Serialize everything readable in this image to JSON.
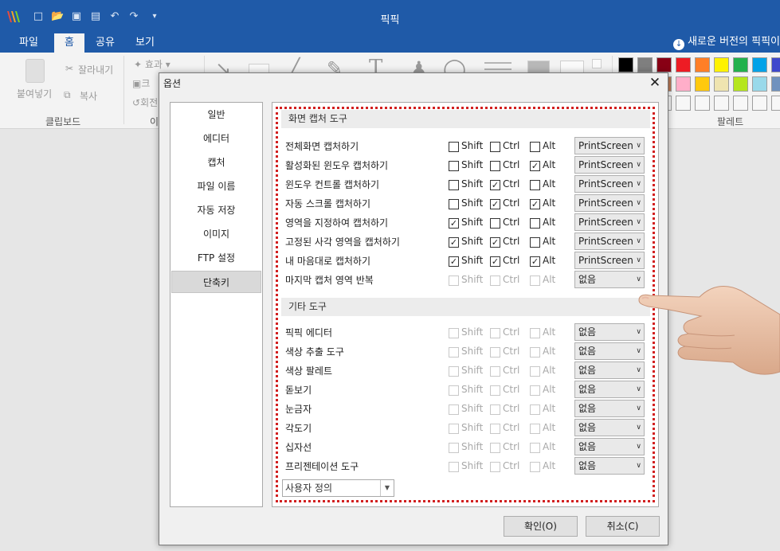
{
  "app": {
    "title": "픽픽"
  },
  "menu": {
    "tabs": [
      "파일",
      "홈",
      "공유",
      "보기"
    ],
    "update_notice": "새로운 버전의 픽픽이"
  },
  "ribbon": {
    "paste_label": "붙여넣기",
    "cut_label": "잘라내기",
    "copy_label": "복사",
    "effect_label": "효과",
    "crop_label": "크",
    "rotate_label": "회전",
    "clipboard_group": "클립보드",
    "image_group": "이",
    "palette_group": "팔레트",
    "palette_colors": [
      "#000000",
      "#7f7f7f",
      "#880015",
      "#ed1c24",
      "#ff7f27",
      "#fff200",
      "#22b14c",
      "#00a2e8",
      "#3f48cc",
      "#ffffff",
      "#c3c3c3",
      "#b97a57",
      "#ffaec9",
      "#ffc90e",
      "#efe4b0",
      "#b5e61d",
      "#99d9ea",
      "#7092be"
    ]
  },
  "dialog": {
    "title": "옵션",
    "nav": [
      "일반",
      "에디터",
      "캡처",
      "파일 이름",
      "자동 저장",
      "이미지",
      "FTP 설정",
      "단축키"
    ],
    "active_nav": "단축키",
    "modifiers": [
      "Shift",
      "Ctrl",
      "Alt"
    ],
    "sections": [
      {
        "title": "화면 캡처 도구",
        "rows": [
          {
            "label": "전체화면 캡처하기",
            "shift": false,
            "ctrl": false,
            "alt": false,
            "key": "PrintScreen",
            "enabled": true
          },
          {
            "label": "활성화된 윈도우 캡처하기",
            "shift": false,
            "ctrl": false,
            "alt": true,
            "key": "PrintScreen",
            "enabled": true
          },
          {
            "label": "윈도우 컨트롤 캡처하기",
            "shift": false,
            "ctrl": true,
            "alt": false,
            "key": "PrintScreen",
            "enabled": true
          },
          {
            "label": "자동 스크롤 캡처하기",
            "shift": false,
            "ctrl": true,
            "alt": true,
            "key": "PrintScreen",
            "enabled": true
          },
          {
            "label": "영역을 지정하여 캡처하기",
            "shift": true,
            "ctrl": false,
            "alt": false,
            "key": "PrintScreen",
            "enabled": true
          },
          {
            "label": "고정된 사각 영역을 캡처하기",
            "shift": true,
            "ctrl": true,
            "alt": false,
            "key": "PrintScreen",
            "enabled": true
          },
          {
            "label": "내 마음대로 캡처하기",
            "shift": true,
            "ctrl": true,
            "alt": true,
            "key": "PrintScreen",
            "enabled": true
          },
          {
            "label": "마지막 캡처 영역 반복",
            "shift": false,
            "ctrl": false,
            "alt": false,
            "key": "없음",
            "enabled": false
          }
        ]
      },
      {
        "title": "기타 도구",
        "rows": [
          {
            "label": "픽픽 에디터",
            "shift": false,
            "ctrl": false,
            "alt": false,
            "key": "없음",
            "enabled": false
          },
          {
            "label": "색상 추출 도구",
            "shift": false,
            "ctrl": false,
            "alt": false,
            "key": "없음",
            "enabled": false
          },
          {
            "label": "색상 팔레트",
            "shift": false,
            "ctrl": false,
            "alt": false,
            "key": "없음",
            "enabled": false
          },
          {
            "label": "돋보기",
            "shift": false,
            "ctrl": false,
            "alt": false,
            "key": "없음",
            "enabled": false
          },
          {
            "label": "눈금자",
            "shift": false,
            "ctrl": false,
            "alt": false,
            "key": "없음",
            "enabled": false
          },
          {
            "label": "각도기",
            "shift": false,
            "ctrl": false,
            "alt": false,
            "key": "없음",
            "enabled": false
          },
          {
            "label": "십자선",
            "shift": false,
            "ctrl": false,
            "alt": false,
            "key": "없음",
            "enabled": false
          },
          {
            "label": "프리젠테이션 도구",
            "shift": false,
            "ctrl": false,
            "alt": false,
            "key": "없음",
            "enabled": false
          }
        ]
      }
    ],
    "preset": "사용자 정의",
    "ok_label": "확인(O)",
    "cancel_label": "취소(C)"
  },
  "colors": {
    "titlebar": "#1f5aa8",
    "highlight_frame": "#d22020"
  }
}
